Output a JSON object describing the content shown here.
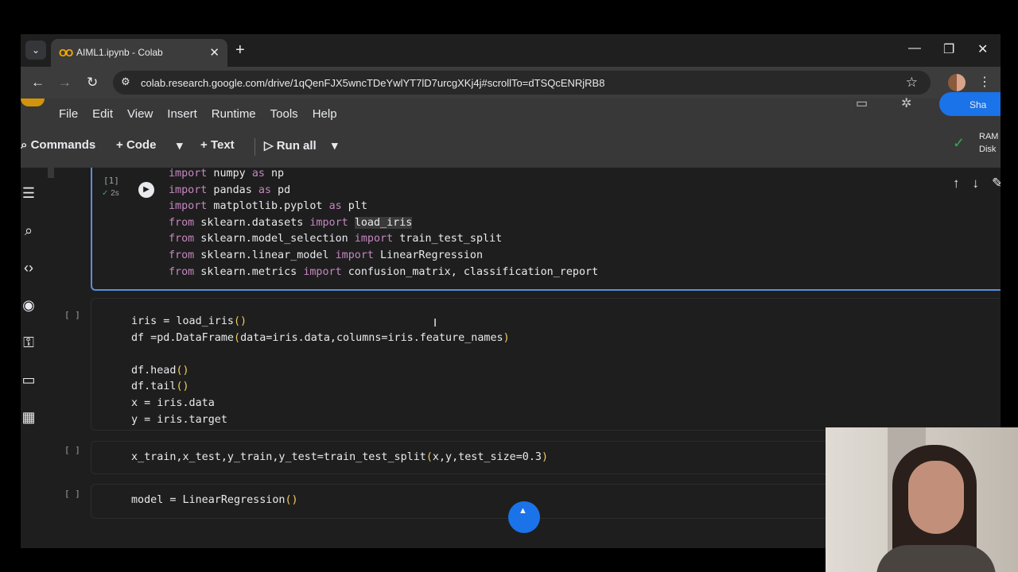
{
  "browser": {
    "tab_title": "AIML1.ipynb - Colab",
    "url": "colab.research.google.com/drive/1qQenFJX5wncTDeYwlYT7lD7urcgXKj4j#scrollTo=dTSQcENRjRB8"
  },
  "menu": [
    "File",
    "Edit",
    "View",
    "Insert",
    "Runtime",
    "Tools",
    "Help"
  ],
  "toolbar": {
    "commands": "Commands",
    "code": "Code",
    "text": "Text",
    "run_all": "Run all",
    "ram": "RAM",
    "disk": "Disk",
    "share_partial": "Sha"
  },
  "cells": [
    {
      "count": "[1]",
      "time": "2s",
      "lines": [
        "import numpy as np",
        "import pandas as pd",
        "import matplotlib.pyplot as plt",
        "from sklearn.datasets import load_iris",
        "from sklearn.model_selection import train_test_split",
        "from sklearn.linear_model import LinearRegression",
        "from sklearn.metrics import confusion_matrix, classification_report"
      ]
    },
    {
      "count": "[ ]",
      "lines": [
        "iris = load_iris()",
        "df =pd.DataFrame(data=iris.data,columns=iris.feature_names)",
        "",
        "df.head()",
        "df.tail()",
        "x = iris.data",
        "y = iris.target"
      ]
    },
    {
      "count": "[ ]",
      "lines": [
        "x_train,x_test,y_train,y_test=train_test_split(x,y,test_size=0.3)"
      ]
    },
    {
      "count": "[ ]",
      "lines": [
        "model = LinearRegression()"
      ]
    }
  ],
  "icons": {
    "tab_menu": "chevron-down-icon",
    "favicon": "colab-logo-icon",
    "close": "close-icon",
    "new_tab": "plus-icon",
    "back": "back-arrow-icon",
    "forward": "forward-arrow-icon",
    "reload": "reload-icon",
    "site_info": "tune-icon",
    "bookmark": "star-icon",
    "run": "play-icon"
  },
  "colors": {
    "keyword": "#c586c0",
    "paren": "#f2cc60",
    "active_cell_border": "#5b8fd8",
    "status_ok": "#34a853"
  }
}
